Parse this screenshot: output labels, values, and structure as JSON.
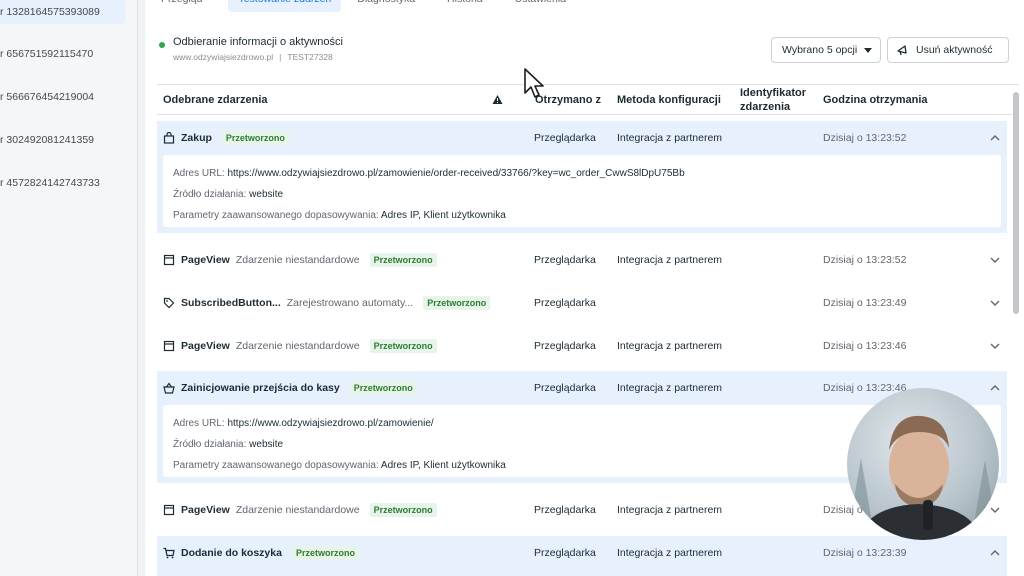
{
  "sidebar": {
    "items": [
      {
        "label": "r 1328164575393089",
        "active": true
      },
      {
        "label": "r 656751592115470",
        "active": false
      },
      {
        "label": "r 566676454219004",
        "active": false
      },
      {
        "label": "r 302492081241359",
        "active": false
      },
      {
        "label": "r 4572824142743733",
        "active": false
      }
    ]
  },
  "tabs": [
    {
      "label": "Przegląd"
    },
    {
      "label": "Testowanie zdarzeń",
      "active": true
    },
    {
      "label": "Diagnostyka"
    },
    {
      "label": "Historia"
    },
    {
      "label": "Ustawienia"
    }
  ],
  "status": {
    "title": "Odbieranie informacji o aktywności",
    "domain": "www.odzywiajsiezdrowo.pl",
    "separator": "|",
    "code": "TEST27328",
    "color": "#2ea650"
  },
  "toolbar": {
    "select_label": "Wybrano 5 opcji",
    "remove_label": "Usuń aktywność",
    "remove_icon": "megaphone-icon"
  },
  "table": {
    "headers": {
      "events": "Odebrane zdarzenia",
      "received_from": "Otrzymano z",
      "config_method": "Metoda konfiguracji",
      "event_id_1": "Identyfikator",
      "event_id_2": "zdarzenia",
      "time": "Godzina otrzymania"
    },
    "rows": [
      {
        "icon": "bag-icon",
        "name": "Zakup",
        "desc": "",
        "status": "Przetworzono",
        "source": "Przeglądarka",
        "method": "Integracja z partnerem",
        "time": "Dzisiaj o 13:23:52",
        "expanded": true,
        "details": {
          "url_label": "Adres URL:",
          "url": "https://www.odzywiajsiezdrowo.pl/zamowienie/order-received/33766/?key=wc_order_CwwS8lDpU75Bb",
          "source_label": "Źródło działania:",
          "source": "website",
          "params_label": "Parametry zaawansowanego dopasowywania:",
          "params": "Adres IP, Klient użytkownika"
        }
      },
      {
        "icon": "page-icon",
        "name": "PageView",
        "desc": "Zdarzenie niestandardowe",
        "status": "Przetworzono",
        "source": "Przeglądarka",
        "method": "Integracja z partnerem",
        "time": "Dzisiaj o 13:23:52",
        "expanded": false
      },
      {
        "icon": "tag-icon",
        "name": "SubscribedButton...",
        "desc": "Zarejestrowano automaty...",
        "status": "Przetworzono",
        "source": "Przeglądarka",
        "method": "",
        "time": "Dzisiaj o 13:23:49",
        "expanded": false
      },
      {
        "icon": "page-icon",
        "name": "PageView",
        "desc": "Zdarzenie niestandardowe",
        "status": "Przetworzono",
        "source": "Przeglądarka",
        "method": "Integracja z partnerem",
        "time": "Dzisiaj o 13:23:46",
        "expanded": false
      },
      {
        "icon": "basket-icon",
        "name": "Zainicjowanie przejścia do kasy",
        "desc": "",
        "status": "Przetworzono",
        "source": "Przeglądarka",
        "method": "Integracja z partnerem",
        "time": "Dzisiaj o 13:23:46",
        "expanded": true,
        "details": {
          "url_label": "Adres URL:",
          "url": "https://www.odzywiajsiezdrowo.pl/zamowienie/",
          "source_label": "Źródło działania:",
          "source": "website",
          "params_label": "Parametry zaawansowanego dopasowywania:",
          "params": "Adres IP, Klient użytkownika"
        }
      },
      {
        "icon": "page-icon",
        "name": "PageView",
        "desc": "Zdarzenie niestandardowe",
        "status": "Przetworzono",
        "source": "Przeglądarka",
        "method": "Integracja z partnerem",
        "time": "Dzisiaj o",
        "expanded": false
      },
      {
        "icon": "cart-icon",
        "name": "Dodanie do koszyka",
        "desc": "",
        "status": "Przetworzono",
        "source": "Przeglądarka",
        "method": "Integracja z partnerem",
        "time": "Dzisiaj o 13:23:39",
        "expanded": true
      }
    ]
  }
}
